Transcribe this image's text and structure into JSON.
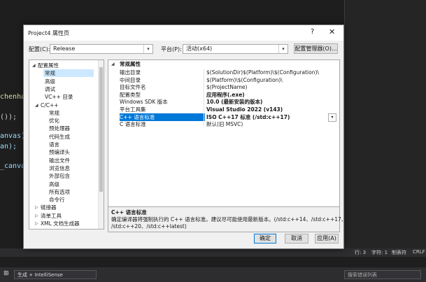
{
  "ide": {
    "code_lines": [
      "chenha",
      "());",
      "anvas)",
      "an);",
      "_canva"
    ],
    "status": {
      "line": "行: 3",
      "char": "字符: 1",
      "tab": "制表符",
      "crlf": "CRLF"
    },
    "build_combo": "生成 + IntelliSense",
    "search_placeholder": "搜索错误列表"
  },
  "dialog": {
    "title": "Project4 属性页",
    "help": "?",
    "close": "✕",
    "config_label": "配置(C):",
    "config_value": "Release",
    "platform_label": "平台(P):",
    "platform_value": "活动(x64)",
    "config_manager": "配置管理器(O)...",
    "ok": "确定",
    "cancel": "取消",
    "apply": "应用(A)"
  },
  "tree": [
    {
      "label": "配置属性",
      "expander": "◢"
    },
    {
      "label": "常规",
      "selected": true
    },
    {
      "label": "高级"
    },
    {
      "label": "调试"
    },
    {
      "label": "VC++ 目录"
    },
    {
      "label": "C/C++",
      "expander": "◢"
    },
    {
      "label": "常规"
    },
    {
      "label": "优化"
    },
    {
      "label": "预处理器"
    },
    {
      "label": "代码生成"
    },
    {
      "label": "语言"
    },
    {
      "label": "预编译头"
    },
    {
      "label": "输出文件"
    },
    {
      "label": "浏览信息"
    },
    {
      "label": "外部包含"
    },
    {
      "label": "高级"
    },
    {
      "label": "所有选项"
    },
    {
      "label": "命令行"
    },
    {
      "label": "链接器",
      "expander": "▷"
    },
    {
      "label": "清单工具",
      "expander": "▷"
    },
    {
      "label": "XML 文档生成器",
      "expander": "▷"
    }
  ],
  "grid": {
    "section": "常规属性",
    "rows": [
      {
        "name": "输出目录",
        "value": "$(SolutionDir)$(Platform)\\$(Configuration)\\"
      },
      {
        "name": "中间目录",
        "value": "$(Platform)\\$(Configuration)\\"
      },
      {
        "name": "目标文件名",
        "value": "$(ProjectName)"
      },
      {
        "name": "配置类型",
        "value": "应用程序(.exe)",
        "bold": true
      },
      {
        "name": "Windows SDK 版本",
        "value": "10.0 (最新安装的版本)",
        "bold": true
      },
      {
        "name": "平台工具集",
        "value": "Visual Studio 2022 (v143)",
        "bold": true
      },
      {
        "name": "C++ 语言标准",
        "value": "ISO C++17 标准 (/std:c++17)",
        "bold": true,
        "selected": true
      },
      {
        "name": "C 语言标准",
        "value": "默认(旧 MSVC)"
      }
    ]
  },
  "description": {
    "title": "C++ 语言标准",
    "line1": "确定编译器将强制执行的 C++ 语言标准。建议尽可能使用最新版本。(/std:c++14、/std:c++17、",
    "line2": "/std:c++20、/std:c++latest)"
  }
}
